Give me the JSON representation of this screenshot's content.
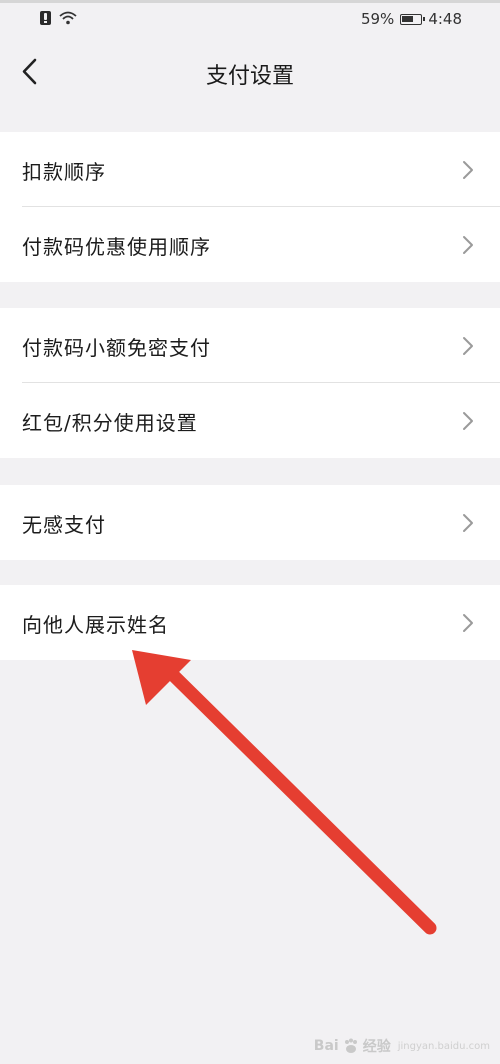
{
  "status_bar": {
    "battery_percent": "59%",
    "time": "4:48"
  },
  "header": {
    "title": "支付设置"
  },
  "groups": [
    {
      "items": [
        {
          "label": "扣款顺序"
        },
        {
          "label": "付款码优惠使用顺序"
        }
      ]
    },
    {
      "items": [
        {
          "label": "付款码小额免密支付"
        },
        {
          "label": "红包/积分使用设置"
        }
      ]
    },
    {
      "items": [
        {
          "label": "无感支付"
        }
      ]
    },
    {
      "items": [
        {
          "label": "向他人展示姓名"
        }
      ]
    }
  ],
  "annotation": {
    "arrow_color": "#e53e31",
    "points_to": "向他人展示姓名"
  },
  "watermark": {
    "text": "Bai",
    "suffix": "经验",
    "sub": "jingyan.baidu.com"
  },
  "colors": {
    "background": "#f2f1f3",
    "card": "#ffffff",
    "text": "#1a1a1a",
    "chevron": "#9a9a9a"
  }
}
